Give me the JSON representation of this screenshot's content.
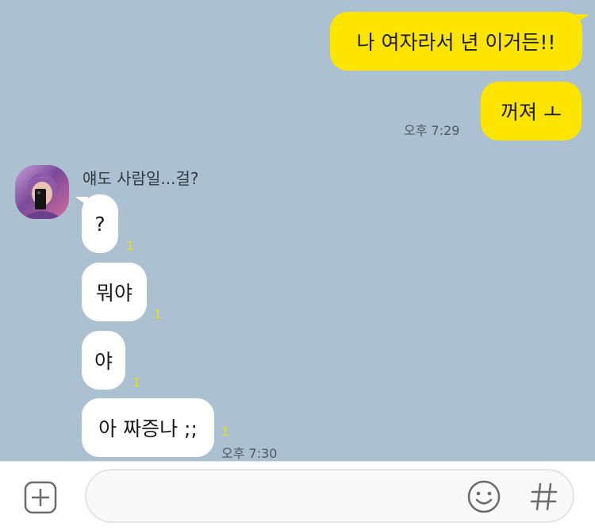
{
  "chat": {
    "background_color": "#abc1d1",
    "my_bubble_color": "#fee500",
    "their_bubble_color": "#ffffff",
    "messages_sent": [
      {
        "text": "나 여자라서 년 이거든!!"
      },
      {
        "text": "꺼져 ㅗ",
        "time": "오후 7:29"
      }
    ],
    "sender_name": "얘도 사람일...걸?",
    "messages_received": [
      {
        "text": "?",
        "unread": "1"
      },
      {
        "text": "뭐야",
        "unread": "1"
      },
      {
        "text": "야",
        "unread": "1"
      },
      {
        "text": "아 짜증나 ;;",
        "unread": "1",
        "time": "오후 7:30"
      }
    ]
  },
  "input_bar": {
    "placeholder": "",
    "icons": [
      "plus-square-icon",
      "emoji-smile-icon",
      "hash-icon"
    ]
  }
}
